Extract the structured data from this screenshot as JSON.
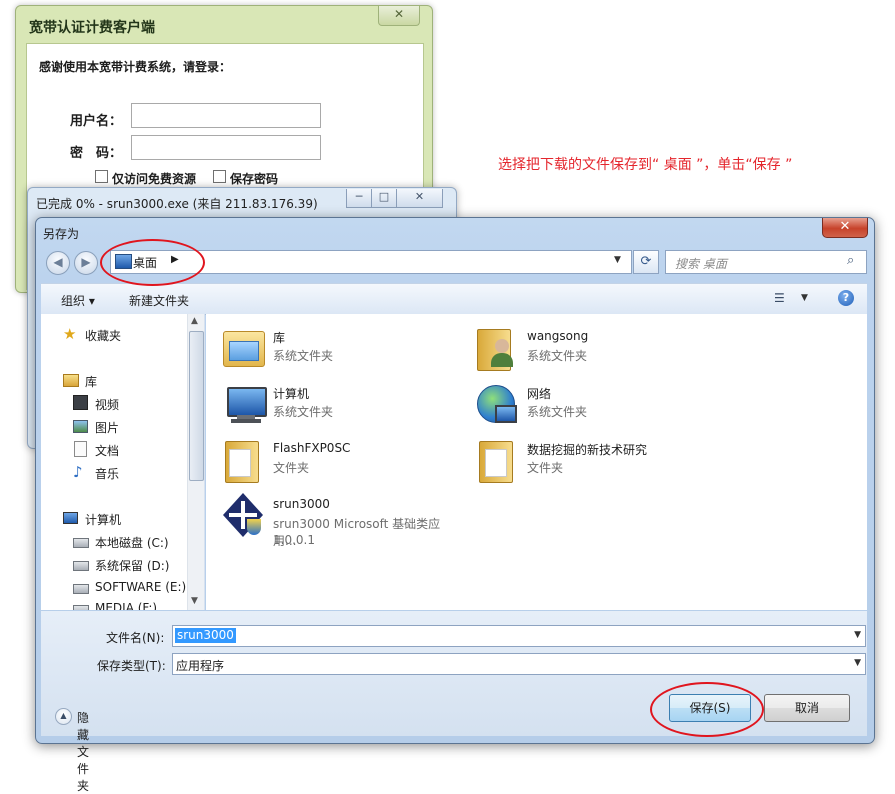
{
  "client": {
    "title": "宽带认证计费客户端",
    "close": "✕",
    "welcome": "感谢使用本宽带计费系统，请登录：",
    "username_label": "用户名：",
    "password_label": "密　码：",
    "free_only": "仅访问免费资源",
    "save_password": "保存密码"
  },
  "download": {
    "title": "已完成 0% - srun3000.exe (来自 211.83.176.39)",
    "minimize": "─",
    "maximize": "□",
    "close": "✕"
  },
  "dialog": {
    "title": "另存为",
    "close": "✕",
    "back": "◀",
    "forward": "▶",
    "address": "桌面",
    "address_arrow": "▶",
    "search_placeholder": "搜索 桌面",
    "toolbar": {
      "organize": "组织 ▾",
      "new_folder": "新建文件夹",
      "help": "?",
      "view": "☰",
      "view_dd": "▼"
    },
    "nav": [
      {
        "label": "收藏夹",
        "icon": "star-icon"
      },
      {
        "label": "库",
        "icon": "library-icon"
      },
      {
        "label": "视频",
        "icon": "video-icon"
      },
      {
        "label": "图片",
        "icon": "picture-icon"
      },
      {
        "label": "文档",
        "icon": "document-icon"
      },
      {
        "label": "音乐",
        "icon": "music-icon"
      },
      {
        "label": "计算机",
        "icon": "computer-icon"
      },
      {
        "label": "本地磁盘 (C:)",
        "icon": "drive-icon"
      },
      {
        "label": "系统保留 (D:)",
        "icon": "drive-icon"
      },
      {
        "label": "SOFTWARE (E:)",
        "icon": "drive-icon"
      },
      {
        "label": "MEDIA (F:)",
        "icon": "drive-icon"
      }
    ],
    "files": [
      {
        "name": "库",
        "type": "系统文件夹",
        "icon": "library-folder-icon"
      },
      {
        "name": "wangsong",
        "type": "系统文件夹",
        "icon": "user-folder-icon"
      },
      {
        "name": "计算机",
        "type": "系统文件夹",
        "icon": "computer-icon"
      },
      {
        "name": "网络",
        "type": "系统文件夹",
        "icon": "network-globe-icon"
      },
      {
        "name": "FlashFXP0SC",
        "type": "文件夹",
        "icon": "folder-icon"
      },
      {
        "name": "数据挖掘的新技术研究",
        "type": "文件夹",
        "icon": "folder-icon"
      },
      {
        "name": "srun3000",
        "type": "srun3000 Microsoft 基础类应用...",
        "version": "1.0.0.1",
        "icon": "srun-app-icon"
      }
    ],
    "filename_label": "文件名(N):",
    "filename_value": "srun3000",
    "filetype_label": "保存类型(T):",
    "filetype_value": "应用程序",
    "hide_folders": "隐藏文件夹",
    "save_button": "保存(S)",
    "cancel_button": "取消"
  },
  "annotation": "选择把下载的文件保存到“ 桌面 ”，单击“保存 ”",
  "colors": {
    "annotation": "#e4262d",
    "highlight": "#3399ff"
  }
}
